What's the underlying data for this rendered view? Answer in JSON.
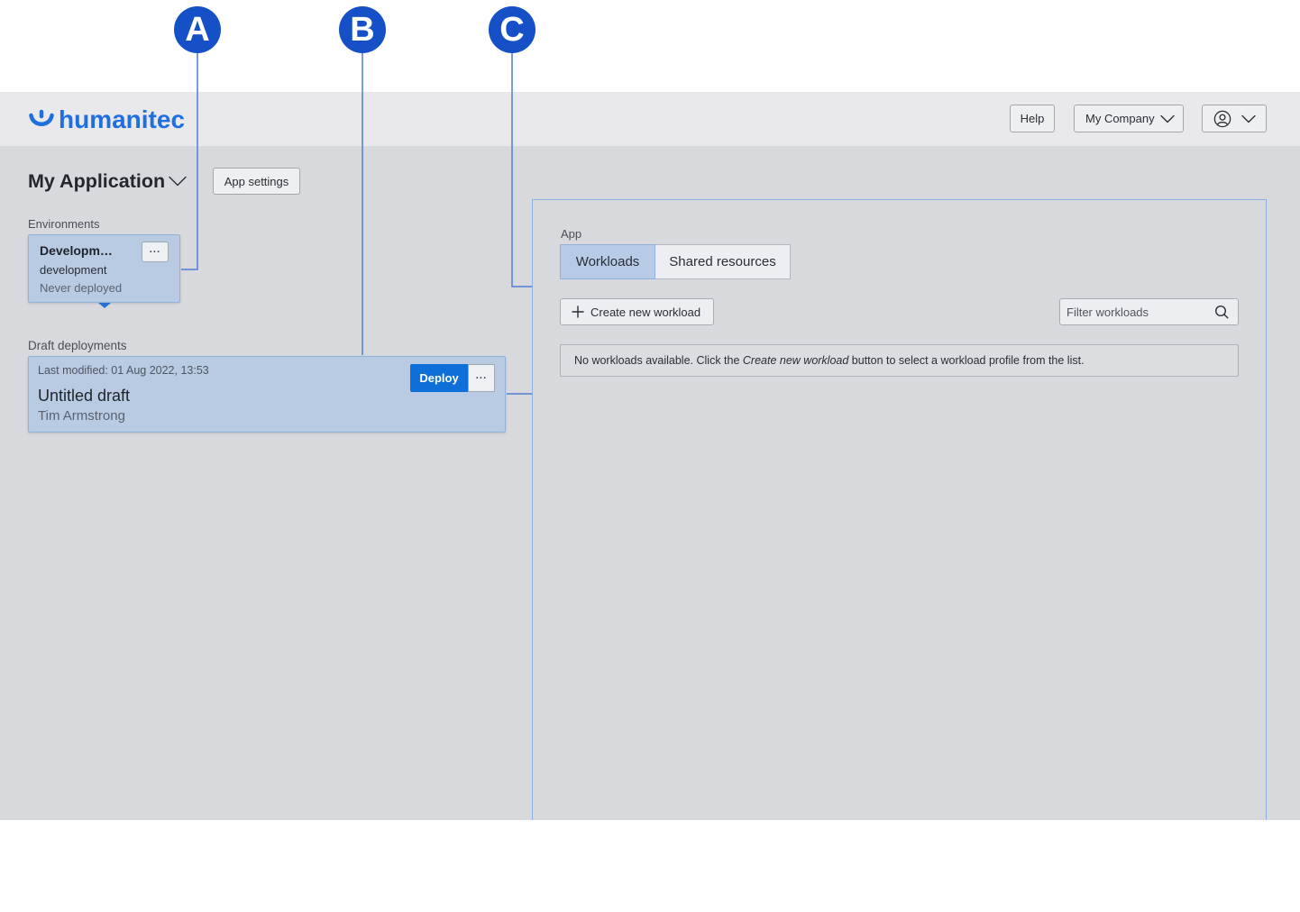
{
  "callouts": [
    "A",
    "B",
    "C"
  ],
  "header": {
    "logo_text": "humanitec",
    "logo_icon": "humanitec-logo-icon",
    "help_label": "Help",
    "company_label": "My Company",
    "company_icon": "chevron-down-icon",
    "user_icon": "user-circle-icon"
  },
  "app": {
    "title": "My Application",
    "title_icon": "chevron-down-icon",
    "settings_label": "App settings"
  },
  "environments": {
    "label": "Environments",
    "items": [
      {
        "name": "Developm…",
        "env_id": "development",
        "status": "Never deployed",
        "menu_label": "···",
        "selected": true
      }
    ]
  },
  "drafts": {
    "label": "Draft deployments",
    "items": [
      {
        "modified": "Last modified: 01 Aug 2022, 13:53",
        "title": "Untitled draft",
        "author": "Tim Armstrong",
        "deploy_label": "Deploy",
        "menu_label": "···"
      }
    ]
  },
  "panel": {
    "section_label": "App",
    "tabs": [
      {
        "label": "Workloads",
        "active": true
      },
      {
        "label": "Shared resources",
        "active": false
      }
    ],
    "create_label": "Create new workload",
    "create_icon": "plus-icon",
    "filter_placeholder": "Filter workloads",
    "filter_icon": "search-icon",
    "empty_message": {
      "before": "No workloads available. Click the ",
      "emphasis": "Create new workload",
      "after": " button to select a workload profile from the list."
    }
  },
  "colors": {
    "brand": "#1f6fe0",
    "callout": "#1650c6",
    "deploy": "#0e6fd8",
    "card": "#b8cbe3",
    "page": "#d8d9dd",
    "header": "#e9e9eb",
    "line": "#4d7fd6"
  }
}
